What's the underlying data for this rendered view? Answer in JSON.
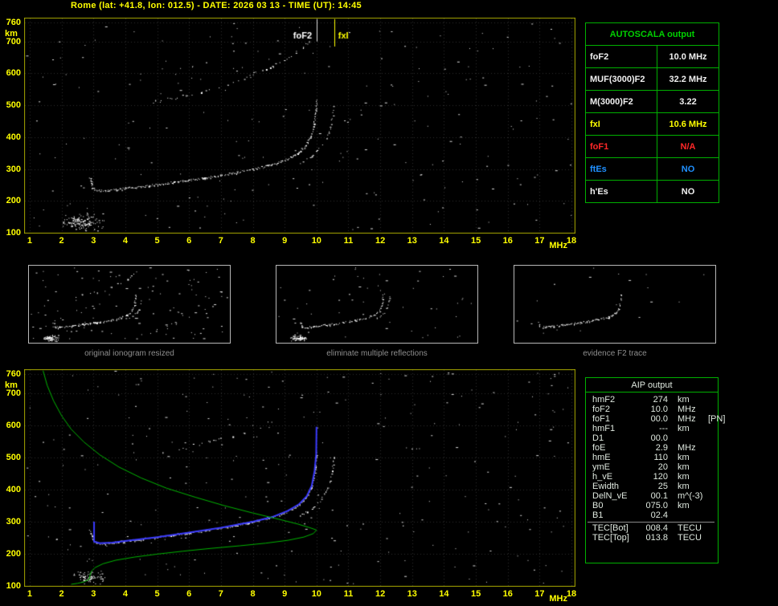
{
  "header": {
    "title": "Rome (lat: +41.8, lon: 012.5) - DATE: 2026 03 13 - TIME (UT): 14:45"
  },
  "colors": {
    "background": "#000000",
    "axis_text": "#ffff00",
    "frame": "#a6a600",
    "grid": "#2c2c2c",
    "table_border": "#00b000",
    "trace": "#ffffff",
    "profile_green": "#00b400",
    "fitted_blue": "#3a3aff",
    "caption_gray": "#8e8e8e"
  },
  "autoscala": {
    "title": "AUTOSCALA output",
    "rows": [
      {
        "label": "foF2",
        "value": "10.0 MHz",
        "color": "#f0f0f0"
      },
      {
        "label": "MUF(3000)F2",
        "value": "32.2 MHz",
        "color": "#f0f0f0"
      },
      {
        "label": "M(3000)F2",
        "value": "3.22",
        "color": "#f0f0f0"
      },
      {
        "label": "fxI",
        "value": "10.6 MHz",
        "color": "#ffff00"
      },
      {
        "label": "foF1",
        "value": "N/A",
        "color": "#ff2828"
      },
      {
        "label": "ftEs",
        "value": "NO",
        "color": "#2090ff"
      },
      {
        "label": "h'Es",
        "value": "NO",
        "color": "#f0f0f0"
      }
    ]
  },
  "thumbnails": [
    {
      "caption": "original ionogram resized",
      "include": [
        "f2-trace",
        "x-mode-trace",
        "second-hop",
        "e-region-cluster"
      ],
      "noise": 130,
      "seed": 41
    },
    {
      "caption": "eliminate multiple reflections",
      "include": [
        "f2-trace",
        "x-mode-trace",
        "e-region-cluster"
      ],
      "noise": 55,
      "seed": 43
    },
    {
      "caption": "evidence F2 trace",
      "include": [
        "f2-trace"
      ],
      "noise": 18,
      "seed": 47
    }
  ],
  "aip": {
    "title": "AIP output",
    "rows": [
      {
        "label": "hmF2",
        "value": "274",
        "unit": "km",
        "extra": ""
      },
      {
        "label": "foF2",
        "value": "10.0",
        "unit": "MHz",
        "extra": ""
      },
      {
        "label": "foF1",
        "value": "00.0",
        "unit": "MHz",
        "extra": "[PN]"
      },
      {
        "label": "hmF1",
        "value": "---",
        "unit": "km",
        "extra": ""
      },
      {
        "label": "D1",
        "value": "00.0",
        "unit": "",
        "extra": ""
      },
      {
        "label": "foE",
        "value": "2.9",
        "unit": "MHz",
        "extra": ""
      },
      {
        "label": "hmE",
        "value": "110",
        "unit": "km",
        "extra": ""
      },
      {
        "label": "ymE",
        "value": "20",
        "unit": "km",
        "extra": ""
      },
      {
        "label": "h_vE",
        "value": "120",
        "unit": "km",
        "extra": ""
      },
      {
        "label": "Ewidth",
        "value": "25",
        "unit": "km",
        "extra": ""
      },
      {
        "label": "DelN_vE",
        "value": "00.1",
        "unit": "m^(-3)",
        "extra": ""
      },
      {
        "label": "B0",
        "value": "075.0",
        "unit": "km",
        "extra": ""
      },
      {
        "label": "B1",
        "value": "02.4",
        "unit": "",
        "extra": ""
      }
    ],
    "tec_rows": [
      {
        "label": "TEC[Bot]",
        "value": "008.4",
        "unit": "TECU"
      },
      {
        "label": "TEC[Top]",
        "value": "013.8",
        "unit": "TECU"
      }
    ]
  },
  "chart_data": [
    {
      "id": "ionogram-top",
      "type": "scatter",
      "title": "autoscaled ionogram",
      "xlabel": "MHz",
      "ylabel": "km",
      "xlim": [
        0.85,
        18.1
      ],
      "ylim": [
        100,
        772
      ],
      "xticks": [
        1,
        2,
        3,
        4,
        5,
        6,
        7,
        8,
        9,
        10,
        11,
        12,
        13,
        14,
        15,
        16,
        17,
        18
      ],
      "yticks": [
        760,
        700,
        600,
        500,
        400,
        300,
        200,
        100
      ],
      "grid": true,
      "frame": true,
      "annotations": [
        {
          "type": "vline",
          "f": 10.0,
          "km_from": 770,
          "km_to": 700,
          "color": "#e0e0e0"
        },
        {
          "type": "vline",
          "f": 10.55,
          "km_from": 770,
          "km_to": 684,
          "color": "#ffff00"
        },
        {
          "type": "text",
          "text": "foF2",
          "f": 9.27,
          "km": 731,
          "color": "#ffffff"
        },
        {
          "type": "text",
          "text": "fxI",
          "f": 10.68,
          "km": 731,
          "color": "#ffff00"
        }
      ],
      "series": [
        {
          "name": "f2-trace",
          "mode": "dots",
          "color": "#ffffff",
          "seed": 3,
          "step": 1.6,
          "density": 0.95,
          "jitter": [
            0.8,
            1.2
          ],
          "points": [
            [
              2.88,
              274
            ],
            [
              2.97,
              242
            ],
            [
              3.1,
              233
            ],
            [
              3.5,
              233
            ],
            [
              4,
              240
            ],
            [
              4.5,
              246
            ],
            [
              5,
              252
            ],
            [
              5.5,
              259
            ],
            [
              6,
              266
            ],
            [
              6.5,
              273
            ],
            [
              7,
              281
            ],
            [
              7.5,
              290
            ],
            [
              8,
              300
            ],
            [
              8.5,
              312
            ],
            [
              8.9,
              324
            ],
            [
              9.2,
              338
            ],
            [
              9.45,
              354
            ],
            [
              9.65,
              374
            ],
            [
              9.8,
              400
            ],
            [
              9.9,
              434
            ],
            [
              9.96,
              472
            ],
            [
              10.0,
              518
            ]
          ]
        },
        {
          "name": "x-mode-trace",
          "mode": "dots",
          "color": "#ffffff",
          "seed": 5,
          "step": 2.5,
          "density": 0.6,
          "jitter": [
            0.8,
            1.2
          ],
          "points": [
            [
              9.5,
              320
            ],
            [
              9.85,
              342
            ],
            [
              10.1,
              366
            ],
            [
              10.3,
              394
            ],
            [
              10.42,
              428
            ],
            [
              10.5,
              465
            ],
            [
              10.55,
              505
            ]
          ]
        },
        {
          "name": "second-hop",
          "mode": "dots",
          "color": "#ffffff",
          "seed": 7,
          "step": 3,
          "density": 0.5,
          "jitter": [
            1.4,
            2
          ],
          "points": [
            [
              4.9,
              512
            ],
            [
              5.4,
              521
            ],
            [
              5.9,
              531
            ],
            [
              6.4,
              543
            ],
            [
              6.9,
              557
            ],
            [
              7.4,
              573
            ],
            [
              7.9,
              591
            ],
            [
              8.4,
              612
            ],
            [
              8.8,
              633
            ],
            [
              9.2,
              656
            ],
            [
              9.55,
              680
            ],
            [
              9.8,
              705
            ]
          ]
        },
        {
          "name": "e-region-cluster",
          "mode": "cluster",
          "color": "#ffffff",
          "seed": 9,
          "count": 140,
          "area": [
            1.95,
            3.4,
            104,
            166
          ]
        }
      ],
      "noise": {
        "count": 230,
        "seed": 11
      }
    },
    {
      "id": "ionogram-bottom-with-profile",
      "type": "scatter",
      "title": "ionogram with fitted F2 trace and electron density profile",
      "xlabel": "MHz",
      "ylabel": "km",
      "xlim": [
        0.85,
        18.1
      ],
      "ylim": [
        100,
        772
      ],
      "xticks": [
        1,
        2,
        3,
        4,
        5,
        6,
        7,
        8,
        9,
        10,
        11,
        12,
        13,
        14,
        15,
        16,
        17,
        18
      ],
      "yticks": [
        760,
        700,
        600,
        500,
        400,
        300,
        200,
        100
      ],
      "grid": true,
      "frame": true,
      "annotations": [],
      "series": [
        {
          "name": "f2-trace",
          "mode": "dots",
          "color": "#ffffff",
          "seed": 4,
          "step": 1.6,
          "density": 0.95,
          "jitter": [
            0.8,
            1.2
          ],
          "points": [
            [
              2.88,
              274
            ],
            [
              2.97,
              242
            ],
            [
              3.1,
              233
            ],
            [
              3.5,
              233
            ],
            [
              4,
              240
            ],
            [
              4.5,
              246
            ],
            [
              5,
              252
            ],
            [
              5.5,
              259
            ],
            [
              6,
              266
            ],
            [
              6.5,
              273
            ],
            [
              7,
              281
            ],
            [
              7.5,
              290
            ],
            [
              8,
              300
            ],
            [
              8.5,
              312
            ],
            [
              8.9,
              324
            ],
            [
              9.2,
              338
            ],
            [
              9.45,
              354
            ],
            [
              9.65,
              374
            ],
            [
              9.8,
              400
            ],
            [
              9.9,
              434
            ],
            [
              9.96,
              472
            ],
            [
              10.0,
              518
            ]
          ]
        },
        {
          "name": "x-mode-trace",
          "mode": "dots",
          "color": "#ffffff",
          "seed": 6,
          "step": 2.5,
          "density": 0.6,
          "jitter": [
            0.8,
            1.2
          ],
          "points": [
            [
              9.5,
              320
            ],
            [
              9.85,
              342
            ],
            [
              10.1,
              366
            ],
            [
              10.3,
              394
            ],
            [
              10.42,
              428
            ],
            [
              10.5,
              465
            ],
            [
              10.55,
              505
            ]
          ]
        },
        {
          "name": "second-hop-residue",
          "mode": "dots",
          "color": "#ffffff",
          "seed": 8,
          "step": 3.5,
          "density": 0.32,
          "jitter": [
            1.5,
            2
          ],
          "points": [
            [
              5.2,
              518
            ],
            [
              5.8,
              530
            ],
            [
              6.4,
              543
            ],
            [
              7.0,
              558
            ],
            [
              7.6,
              576
            ],
            [
              8.2,
              596
            ],
            [
              8.6,
              614
            ]
          ]
        },
        {
          "name": "e-region-cluster",
          "mode": "cluster",
          "color": "#ffffff",
          "seed": 10,
          "count": 70,
          "area": [
            2.3,
            3.4,
            104,
            150
          ]
        },
        {
          "name": "fitted-f2-trace",
          "mode": "line",
          "color": "#3a3aff",
          "width": 2,
          "points": [
            [
              3.02,
              300
            ],
            [
              3.02,
              238
            ],
            [
              3.2,
              233
            ],
            [
              3.6,
              235
            ],
            [
              4,
              240
            ],
            [
              5,
              252
            ],
            [
              6,
              266
            ],
            [
              7,
              281
            ],
            [
              8,
              300
            ],
            [
              8.6,
              314
            ],
            [
              9.1,
              334
            ],
            [
              9.45,
              354
            ],
            [
              9.7,
              380
            ],
            [
              9.85,
              412
            ],
            [
              9.94,
              458
            ],
            [
              9.99,
              510
            ],
            [
              10.0,
              595
            ]
          ]
        },
        {
          "name": "electron-density-profile",
          "mode": "line",
          "color": "#00b400",
          "width": 1,
          "points": [
            [
              1.42,
              770
            ],
            [
              1.55,
              724
            ],
            [
              1.75,
              676
            ],
            [
              2.0,
              630
            ],
            [
              2.3,
              588
            ],
            [
              2.7,
              548
            ],
            [
              3.2,
              508
            ],
            [
              3.8,
              470
            ],
            [
              4.5,
              436
            ],
            [
              5.3,
              404
            ],
            [
              6.2,
              376
            ],
            [
              7.1,
              350
            ],
            [
              8.0,
              327
            ],
            [
              8.8,
              308
            ],
            [
              9.4,
              293
            ],
            [
              9.8,
              281
            ],
            [
              10.0,
              274
            ],
            [
              9.9,
              263
            ],
            [
              9.6,
              252
            ],
            [
              9.1,
              242
            ],
            [
              8.4,
              233
            ],
            [
              7.6,
              225
            ],
            [
              6.7,
              217
            ],
            [
              5.8,
              208
            ],
            [
              5.0,
              199
            ],
            [
              4.3,
              190
            ],
            [
              3.7,
              180
            ],
            [
              3.3,
              169
            ],
            [
              3.05,
              157
            ],
            [
              2.93,
              145
            ],
            [
              2.89,
              133
            ],
            [
              2.87,
              121
            ],
            [
              2.72,
              113
            ],
            [
              2.5,
              108
            ],
            [
              2.3,
              105
            ]
          ]
        }
      ],
      "noise": {
        "count": 270,
        "seed": 29
      }
    }
  ]
}
